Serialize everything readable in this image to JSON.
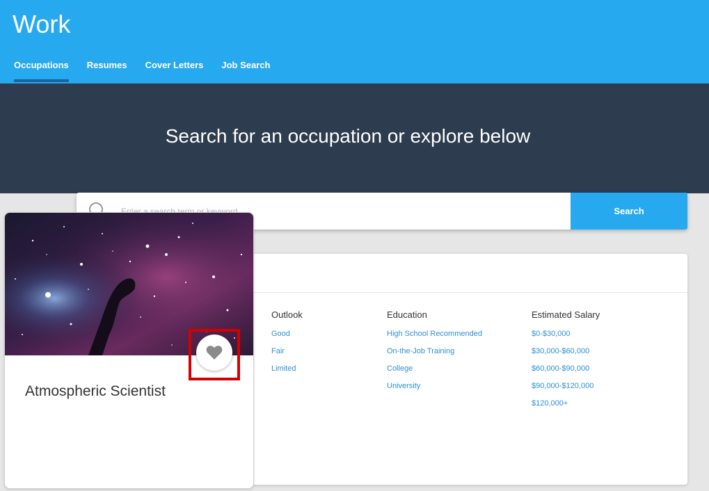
{
  "app": {
    "title": "Work"
  },
  "nav": {
    "tabs": [
      {
        "label": "Occupations",
        "active": true
      },
      {
        "label": "Resumes",
        "active": false
      },
      {
        "label": "Cover Letters",
        "active": false
      },
      {
        "label": "Job Search",
        "active": false
      }
    ]
  },
  "hero": {
    "heading": "Search for an occupation or explore below"
  },
  "search": {
    "placeholder": "Enter a search term or keyword",
    "button_label": "Search"
  },
  "filters": {
    "outlook": {
      "heading": "Outlook",
      "options": [
        "Good",
        "Fair",
        "Limited"
      ]
    },
    "education": {
      "heading": "Education",
      "options": [
        "High School Recommended",
        "On-the-Job Training",
        "College",
        "University"
      ]
    },
    "salary": {
      "heading": "Estimated Salary",
      "options": [
        "$0-$30,000",
        "$30,000-$60,000",
        "$60,000-$90,000",
        "$90,000-$120,000",
        "$120,000+"
      ]
    }
  },
  "card": {
    "title": "Atmospheric Scientist",
    "image_icon": "nebula-image",
    "favorite_icon": "heart-icon"
  },
  "colors": {
    "header_blue": "#27a9ef",
    "hero_dark": "#2d3c4e",
    "link_blue": "#2b8fd6",
    "highlight_red": "#d40000"
  }
}
